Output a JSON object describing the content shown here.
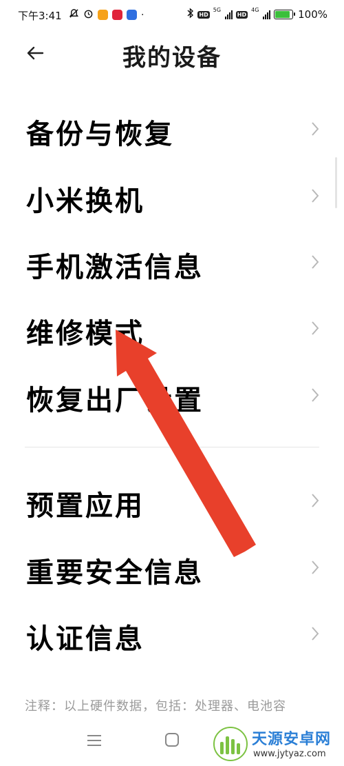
{
  "status_bar": {
    "time": "下午3:41",
    "battery_percent": "100%",
    "network_1": "5G",
    "network_2": "4G",
    "hd_label": "HD"
  },
  "header": {
    "title": "我的设备",
    "back_icon": "arrow-left"
  },
  "menu_group_1": [
    {
      "label": "备份与恢复"
    },
    {
      "label": "小米换机"
    },
    {
      "label": "手机激活信息"
    },
    {
      "label": "维修模式"
    },
    {
      "label": "恢复出厂设置"
    }
  ],
  "menu_group_2": [
    {
      "label": "预置应用"
    },
    {
      "label": "重要安全信息"
    },
    {
      "label": "认证信息"
    }
  ],
  "footnote": "注释：以上硬件数据，包括：处理器、电池容",
  "watermark": {
    "title": "天源安卓网",
    "url": "www.jytyaz.com"
  },
  "colors": {
    "annotation_arrow": "#e8402b",
    "chevron": "#b8b8b8",
    "battery_fill": "#3bbf3b"
  }
}
